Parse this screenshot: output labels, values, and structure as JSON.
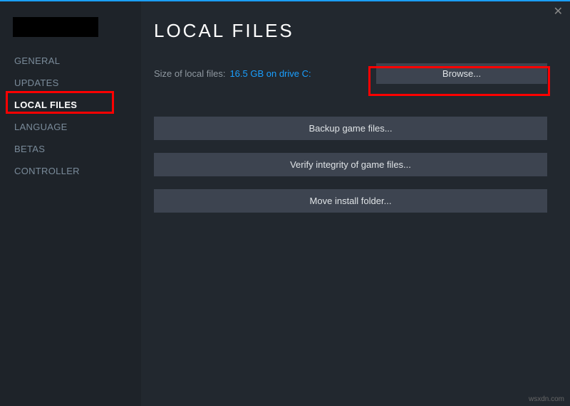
{
  "header": {
    "title": "LOCAL FILES"
  },
  "sidebar": {
    "items": [
      {
        "label": "GENERAL"
      },
      {
        "label": "UPDATES"
      },
      {
        "label": "LOCAL FILES"
      },
      {
        "label": "LANGUAGE"
      },
      {
        "label": "BETAS"
      },
      {
        "label": "CONTROLLER"
      }
    ]
  },
  "size": {
    "label": "Size of local files:",
    "value": "16.5 GB on drive C:"
  },
  "buttons": {
    "browse": "Browse...",
    "backup": "Backup game files...",
    "verify": "Verify integrity of game files...",
    "move": "Move install folder..."
  },
  "watermark": "wsxdn.com"
}
